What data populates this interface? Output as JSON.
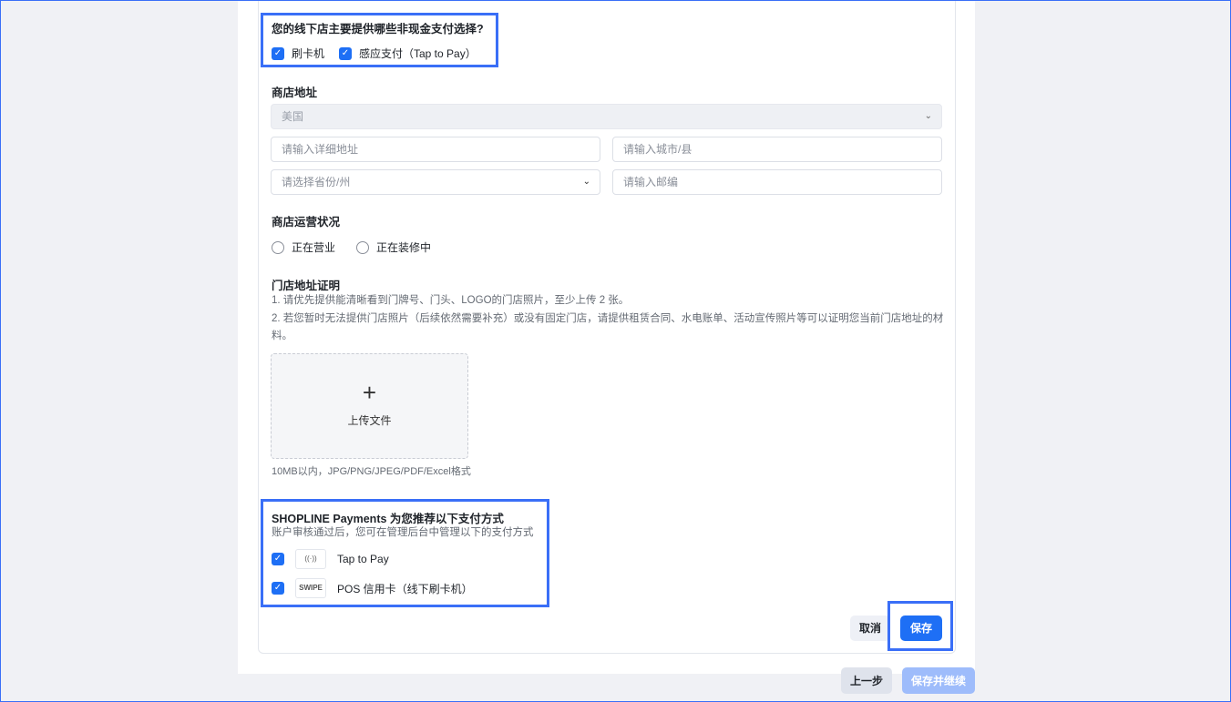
{
  "payment_question": {
    "label": "您的线下店主要提供哪些非现金支付选择?",
    "options": [
      {
        "label": "刷卡机",
        "checked": true
      },
      {
        "label": "感应支付（Tap to Pay）",
        "checked": true
      }
    ]
  },
  "address": {
    "label": "商店地址",
    "country": "美国",
    "detail_placeholder": "请输入详细地址",
    "city_placeholder": "请输入城市/县",
    "state_placeholder": "请选择省份/州",
    "zip_placeholder": "请输入邮编"
  },
  "status": {
    "label": "商店运营状况",
    "options": [
      "正在营业",
      "正在装修中"
    ]
  },
  "proof": {
    "label": "门店地址证明",
    "hint1": "1. 请优先提供能清晰看到门牌号、门头、LOGO的门店照片，至少上传 2 张。",
    "hint2": "2. 若您暂时无法提供门店照片（后续依然需要补充）或没有固定门店，请提供租赁合同、水电账单、活动宣传照片等可以证明您当前门店地址的材料。",
    "upload_label": "上传文件",
    "format_hint": "10MB以内，JPG/PNG/JPEG/PDF/Excel格式"
  },
  "recommend": {
    "title": "SHOPLINE Payments 为您推荐以下支付方式",
    "subtitle": "账户审核通过后，您可在管理后台中管理以下的支付方式",
    "methods": [
      {
        "label": "Tap to Pay",
        "icon_text": "((·))",
        "checked": true
      },
      {
        "label": "POS 信用卡（线下刷卡机）",
        "icon_text": "SWIPE",
        "checked": true
      }
    ]
  },
  "buttons": {
    "cancel": "取消",
    "save": "保存",
    "prev": "上一步",
    "save_continue": "保存并继续"
  },
  "colors": {
    "primary": "#1e6ff5",
    "highlight": "#3a6ff7"
  }
}
